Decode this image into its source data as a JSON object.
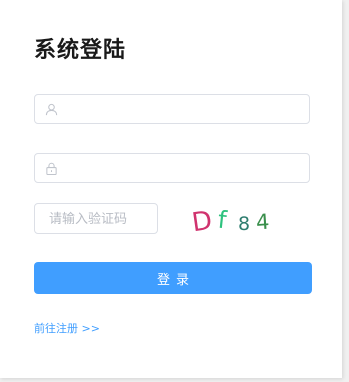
{
  "login": {
    "title": "系统登陆",
    "username": {
      "value": "",
      "placeholder": "",
      "icon": "user-icon"
    },
    "password": {
      "value": "",
      "placeholder": "",
      "icon": "lock-icon"
    },
    "captcha": {
      "placeholder": "请输入验证码",
      "value": "",
      "chars": [
        "D",
        "f",
        "8",
        "4"
      ],
      "colors": [
        "#d0336e",
        "#2ec27e",
        "#2e7d6f",
        "#3a8f4c"
      ]
    },
    "submit_label": "登录",
    "register_link": "前往注册 >>"
  },
  "colors": {
    "primary": "#409eff",
    "border": "#dcdfe6",
    "title": "#1a1a1a"
  }
}
